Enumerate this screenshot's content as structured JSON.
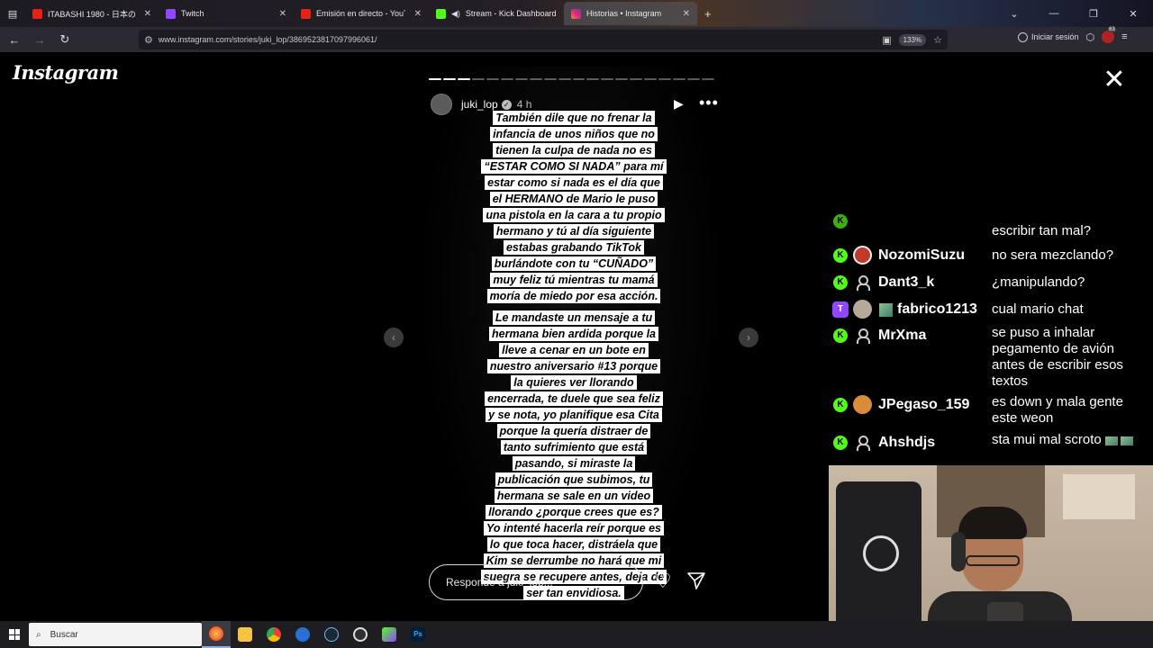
{
  "browser": {
    "tabs": [
      {
        "title": "ITABASHI  1980 - 日本の",
        "favicon_color": "#e62117"
      },
      {
        "title": "Twitch",
        "favicon_color": "#9146ff"
      },
      {
        "title": "Emisión en directo - YouTube S",
        "favicon_color": "#e62117"
      },
      {
        "title": "Stream - Kick Dashboard",
        "favicon_color": "#53fc18"
      },
      {
        "title": "Historias • Instagram",
        "favicon_color": "#d6249f",
        "active": true
      }
    ],
    "url": "www.instagram.com/stories/juki_lop/3869523817097996061/",
    "zoom": "133%",
    "signin_label": "Iniciar sesión",
    "notification_count": "63"
  },
  "instagram": {
    "logo": "Instagram",
    "story": {
      "username": "juki_lop",
      "time": "4 h",
      "progress_total": 20,
      "progress_done": 3,
      "text_block_1": [
        "También dile que no frenar la",
        "infancia de unos niños que no",
        "tienen la culpa de nada no es",
        "“ESTAR COMO SI NADA” para mí",
        "estar como si nada es el día que",
        "el HERMANO de Mario le puso",
        "una pistola en la cara a tu propio",
        "hermano y tú al día siguiente",
        "estabas grabando TikTok",
        "burlándote con tu “CUÑADO”",
        "muy feliz tú mientras tu mamá",
        "moría de miedo por esa acción."
      ],
      "text_block_2": [
        "Le mandaste un mensaje a tu",
        "hermana bien ardida porque la",
        "lleve a cenar en un bote en",
        "nuestro aniversario #13 porque",
        "la quieres ver llorando",
        "encerrada, te duele que sea feliz",
        "y se nota, yo planifique esa Cita",
        "porque la quería distraer de",
        "tanto sufrimiento que está",
        "pasando, si miraste la",
        "publicación que subimos, tu",
        "hermana se sale en un video",
        "llorando  ¿porque crees que es?",
        "Yo intenté hacerla reír porque es",
        "lo que toca hacer, distráela que",
        "Kim se derrumbe no hará que mi",
        "suegra se recupere antes, deja de",
        "ser tan envidiosa."
      ],
      "reply_placeholder": "Responde a juki_lop..."
    }
  },
  "chat": {
    "messages": [
      {
        "user": "",
        "text": "escribir tan mal?",
        "badge": "kick",
        "avatar": "none"
      },
      {
        "user": "NozomiSuzu",
        "text": "no sera mezclando?",
        "badge": "kick",
        "avatar": "#c0392b"
      },
      {
        "user": "Dant3_k",
        "text": "¿manipulando?",
        "badge": "kick",
        "avatar": "person"
      },
      {
        "user": "fabrico1213",
        "text": "cual mario chat",
        "badge": "twitch",
        "avatar": "#b7a89a"
      },
      {
        "user": "MrXma",
        "text": "se puso a inhalar pegamento de avión antes de escribir esos textos",
        "badge": "kick",
        "avatar": "person"
      },
      {
        "user": "JPegaso_159",
        "text": "es down y mala gente este weon",
        "badge": "kick",
        "avatar": "#d98b3a"
      },
      {
        "user": "Ahshdjs",
        "text": "sta mui mal scroto",
        "badge": "kick",
        "avatar": "person"
      }
    ]
  },
  "taskbar": {
    "search_label": "Buscar"
  }
}
